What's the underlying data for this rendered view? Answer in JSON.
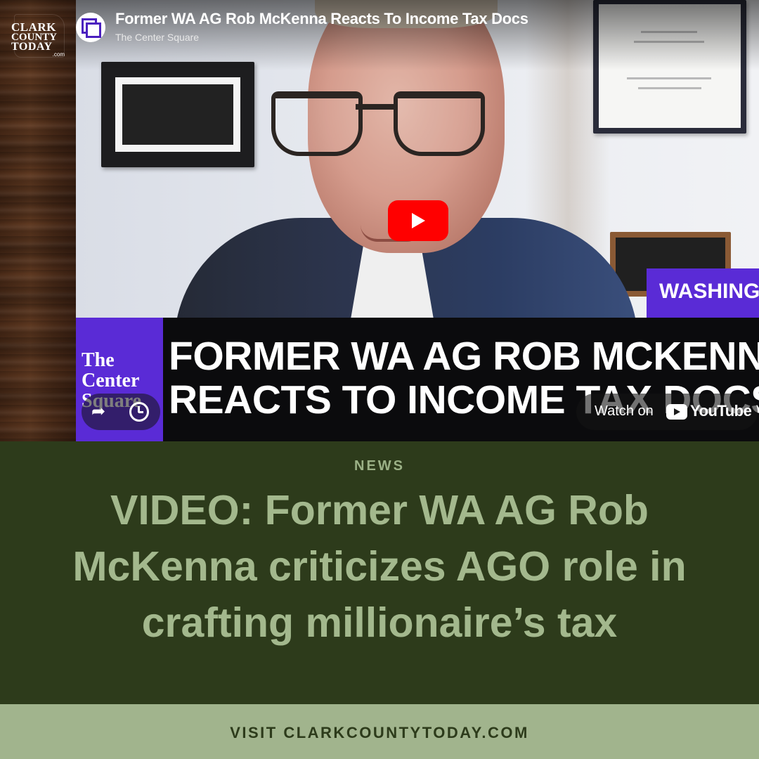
{
  "logo": {
    "line1": "CLARK",
    "line2": "COUNTY",
    "line3": "TODAY",
    "suffix": ".com"
  },
  "video": {
    "title": "Former WA AG Rob McKenna Reacts To Income Tax Docs",
    "channel": "The Center Square",
    "channel_icon": "center-square-logo-icon",
    "play_icon": "play-icon",
    "location_tag": "WASHING",
    "brand_line1": "The",
    "brand_line2": "Center",
    "brand_line3": "Square",
    "headline_line1": "FORMER WA AG ROB MCKENN",
    "headline_line2": "REACTS TO INCOME TAX DOCS",
    "watch_on_label": "Watch on",
    "youtube_label": "YouTube",
    "share_icon": "share-icon",
    "watch_later_icon": "clock-icon"
  },
  "article": {
    "category": "NEWS",
    "title": "VIDEO: Former WA AG Rob McKenna criticizes AGO role in crafting millionaire’s tax"
  },
  "footer": {
    "text": "VISIT CLARKCOUNTYTODAY.COM"
  },
  "colors": {
    "panel_bg": "#2d3b1b",
    "title_text": "#a3b88d",
    "footer_bg": "#a1b48d",
    "brand_purple": "#5a2bd6",
    "youtube_red": "#ff0000"
  }
}
